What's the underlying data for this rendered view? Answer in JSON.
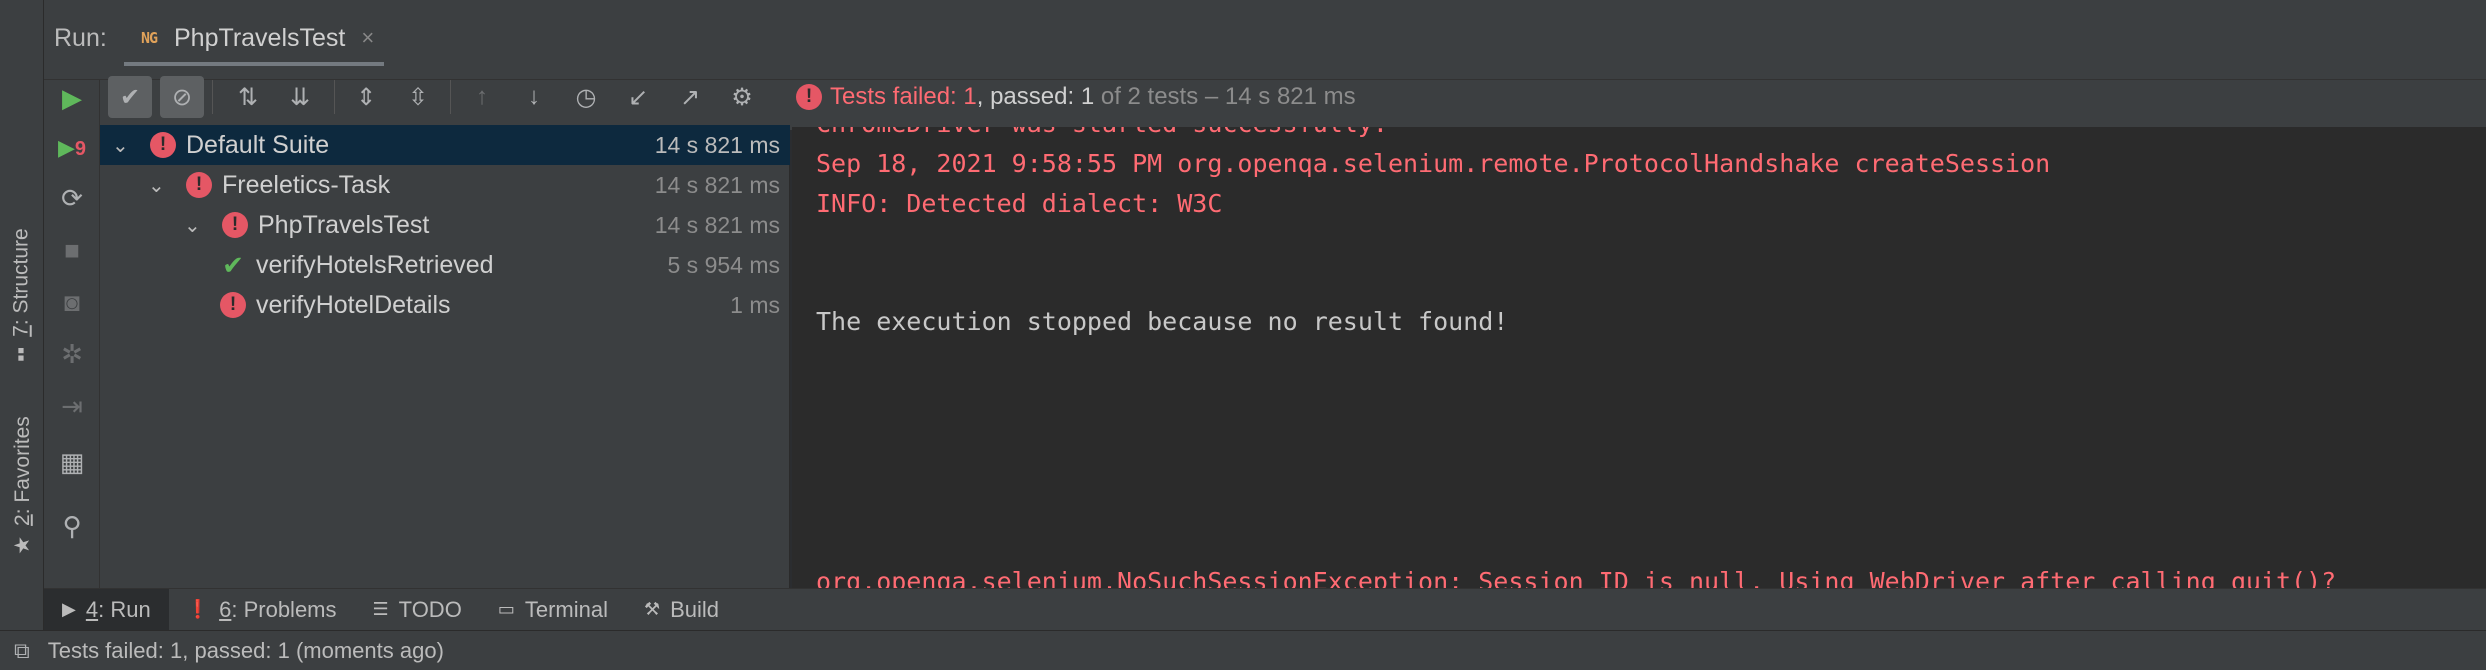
{
  "window": {
    "run_label": "Run:",
    "run_config_icon": "testng-icon",
    "run_tab_title": "PhpTravelsTest",
    "run_tab_close": "×"
  },
  "side_tabs": {
    "structure": {
      "number": "7",
      "label": ": Structure"
    },
    "favorites": {
      "number": "2",
      "label": ": Favorites"
    }
  },
  "test_status": {
    "failed_label": "Tests failed: 1",
    "passed_label": ", passed: 1",
    "total_label": " of 2 tests – 14 s 821 ms"
  },
  "test_tree": [
    {
      "name": "Default Suite",
      "time": "14 s 821 ms",
      "status": "failed",
      "expanded": true,
      "level": 0,
      "selected": true
    },
    {
      "name": "Freeletics-Task",
      "time": "14 s 821 ms",
      "status": "failed",
      "expanded": true,
      "level": 1,
      "selected": false
    },
    {
      "name": "PhpTravelsTest",
      "time": "14 s 821 ms",
      "status": "failed",
      "expanded": true,
      "level": 2,
      "selected": false
    },
    {
      "name": "verifyHotelsRetrieved",
      "time": "5 s 954 ms",
      "status": "passed",
      "level": 3,
      "selected": false
    },
    {
      "name": "verifyHotelDetails",
      "time": "1 ms",
      "status": "failed",
      "level": 3,
      "selected": false
    }
  ],
  "console": {
    "lines": [
      {
        "text": "ChromeDriver was started successfully.",
        "type": "err"
      },
      {
        "text": "Sep 18, 2021 9:58:55 PM org.openqa.selenium.remote.ProtocolHandshake createSession",
        "type": "err"
      },
      {
        "text": "INFO: Detected dialect: W3C",
        "type": "err"
      },
      {
        "text": "The execution stopped because no result found!",
        "type": "out"
      },
      {
        "text": "org.openqa.selenium.NoSuchSessionException: Session ID is null. Using WebDriver after calling quit()?",
        "type": "err"
      }
    ]
  },
  "bottom_tabs": [
    {
      "num": "4",
      "label": ": Run",
      "icon": "play-icon",
      "active": true
    },
    {
      "num": "6",
      "label": ": Problems",
      "icon": "problems-icon",
      "active": false
    },
    {
      "num": "",
      "label": "TODO",
      "icon": "todo-list-icon",
      "active": false
    },
    {
      "num": "",
      "label": "Terminal",
      "icon": "terminal-icon",
      "active": false
    },
    {
      "num": "",
      "label": "Build",
      "icon": "hammer-icon",
      "active": false
    }
  ],
  "status_bar": {
    "message": "Tests failed: 1, passed: 1 (moments ago)"
  },
  "colors": {
    "error": "#ff6b73",
    "success": "#5fb85b",
    "selection": "#0d293e",
    "panel": "#3c3f41",
    "console_bg": "#2b2b2b"
  }
}
